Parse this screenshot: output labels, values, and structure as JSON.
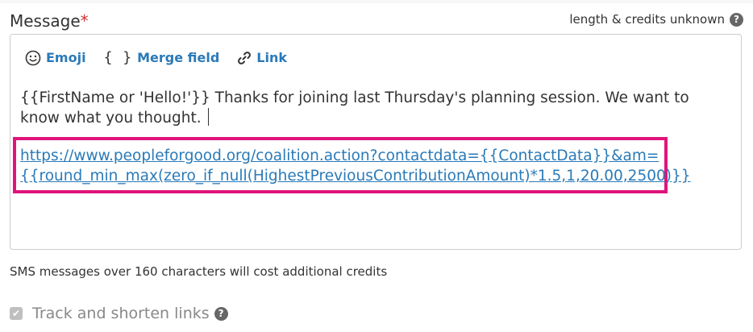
{
  "field": {
    "label": "Message",
    "required_mark": "*",
    "length_info": "length & credits unknown"
  },
  "toolbar": {
    "emoji_label": "Emoji",
    "merge_label": "Merge field",
    "link_label": "Link"
  },
  "editor": {
    "message_text": "{{FirstName or 'Hello!'}} Thanks for joining last Thursday's planning session. We want to know what you thought.",
    "link_line1": "https://www.peopleforgood.org/coalition.action?contactdata={{ContactData}}&am=",
    "link_line2": "{{round_min_max(zero_if_null(HighestPreviousContributionAmount)*1.5,1,20.00,2500)}}"
  },
  "footer": {
    "sms_note": "SMS messages over 160 characters will cost additional credits",
    "track_label": "Track and shorten links",
    "track_checked": true
  },
  "colors": {
    "accent": "#2a7ab8",
    "highlight": "#e0147a",
    "required": "#cc3333"
  },
  "icons": [
    "help-icon",
    "emoji-icon",
    "merge-braces-icon",
    "link-icon",
    "check-icon"
  ]
}
